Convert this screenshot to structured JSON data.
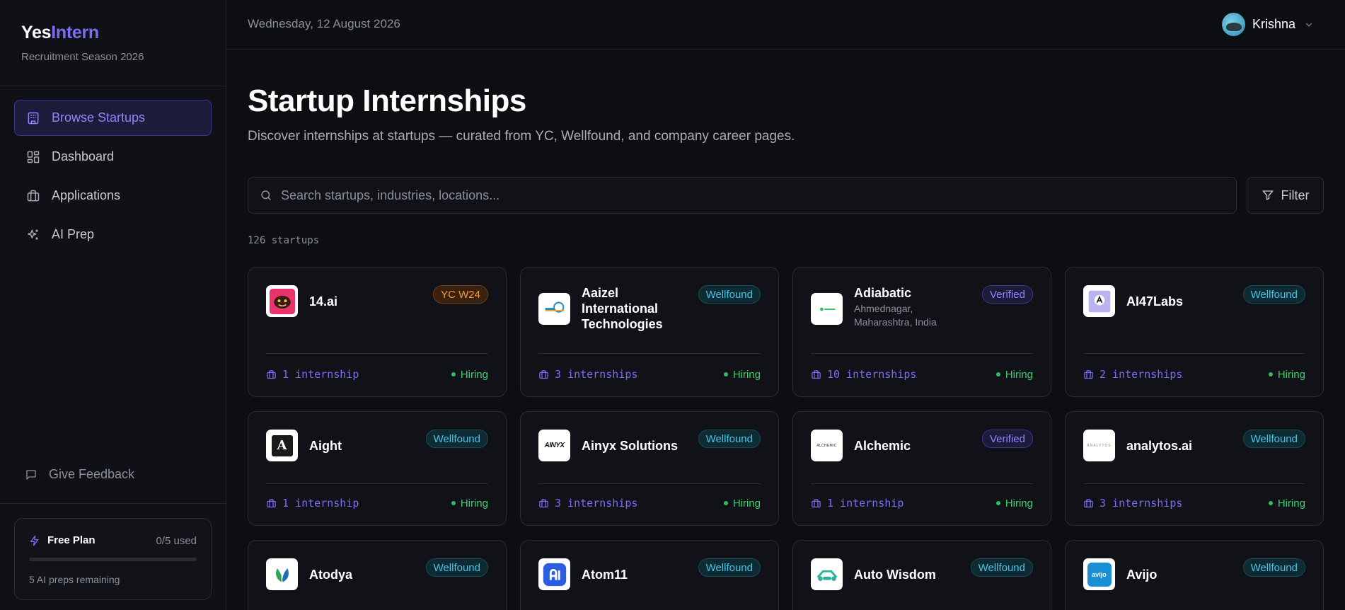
{
  "sidebar": {
    "brand": {
      "part1": "Yes",
      "part2": "Intern"
    },
    "subtitle": "Recruitment Season 2026",
    "nav": [
      {
        "label": "Browse Startups",
        "icon": "building-icon",
        "active": true
      },
      {
        "label": "Dashboard",
        "icon": "dashboard-icon",
        "active": false
      },
      {
        "label": "Applications",
        "icon": "briefcase-icon",
        "active": false
      },
      {
        "label": "AI Prep",
        "icon": "sparkles-icon",
        "active": false
      }
    ],
    "feedback": "Give Feedback",
    "plan": {
      "title": "Free Plan",
      "used": "0/5 used",
      "usage_fraction": 0,
      "remaining": "5 AI preps remaining"
    }
  },
  "topbar": {
    "date": "Wednesday, 12 August 2026",
    "user": "Krishna"
  },
  "main": {
    "title": "Startup Internships",
    "subtitle": "Discover internships at startups — curated from YC, Wellfound, and company career pages.",
    "search_placeholder": "Search startups, industries, locations...",
    "filter_label": "Filter",
    "count": "126 startups"
  },
  "cards": [
    {
      "name": "14.ai",
      "location": "",
      "badge": "YC W24",
      "badge_type": "yc",
      "internships": "1 internship",
      "status": "Hiring",
      "logo_icon": "14ai-logo"
    },
    {
      "name": "Aaizel International Technologies",
      "location": "",
      "badge": "Wellfound",
      "badge_type": "wellfound",
      "internships": "3 internships",
      "status": "Hiring",
      "logo_icon": "aaizel-logo"
    },
    {
      "name": "Adiabatic",
      "location": "Ahmednagar, Maharashtra, India",
      "badge": "Verified",
      "badge_type": "verified",
      "internships": "10 internships",
      "status": "Hiring",
      "logo_icon": "adiabatic-logo"
    },
    {
      "name": "AI47Labs",
      "location": "",
      "badge": "Wellfound",
      "badge_type": "wellfound",
      "internships": "2 internships",
      "status": "Hiring",
      "logo_icon": "ai47labs-logo"
    },
    {
      "name": "Aight",
      "location": "",
      "badge": "Wellfound",
      "badge_type": "wellfound",
      "internships": "1 internship",
      "status": "Hiring",
      "logo_icon": "aight-logo",
      "logo_text": "A"
    },
    {
      "name": "Ainyx Solutions",
      "location": "",
      "badge": "Wellfound",
      "badge_type": "wellfound",
      "internships": "3 internships",
      "status": "Hiring",
      "logo_icon": "ainyx-logo",
      "logo_text": "AINYX"
    },
    {
      "name": "Alchemic",
      "location": "",
      "badge": "Verified",
      "badge_type": "verified",
      "internships": "1 internship",
      "status": "Hiring",
      "logo_icon": "alchemic-logo",
      "logo_text": "ALCHEMIC"
    },
    {
      "name": "analytos.ai",
      "location": "",
      "badge": "Wellfound",
      "badge_type": "wellfound",
      "internships": "3 internships",
      "status": "Hiring",
      "logo_icon": "analytos-logo",
      "logo_text": "ANALYTOS"
    },
    {
      "name": "Atodya",
      "location": "",
      "badge": "Wellfound",
      "badge_type": "wellfound",
      "logo_icon": "atodya-logo"
    },
    {
      "name": "Atom11",
      "location": "",
      "badge": "Wellfound",
      "badge_type": "wellfound",
      "logo_icon": "atom11-logo"
    },
    {
      "name": "Auto Wisdom",
      "location": "",
      "badge": "Wellfound",
      "badge_type": "wellfound",
      "logo_icon": "autowisdom-logo"
    },
    {
      "name": "Avijo",
      "location": "",
      "badge": "Wellfound",
      "badge_type": "wellfound",
      "logo_icon": "avijo-logo",
      "logo_text": "avijo"
    }
  ],
  "colors": {
    "accent": "#7b6cf6",
    "wellfound": "#48c4e8",
    "yc": "#f59a3b",
    "hiring": "#3bd16f",
    "background": "#0d0e12"
  }
}
